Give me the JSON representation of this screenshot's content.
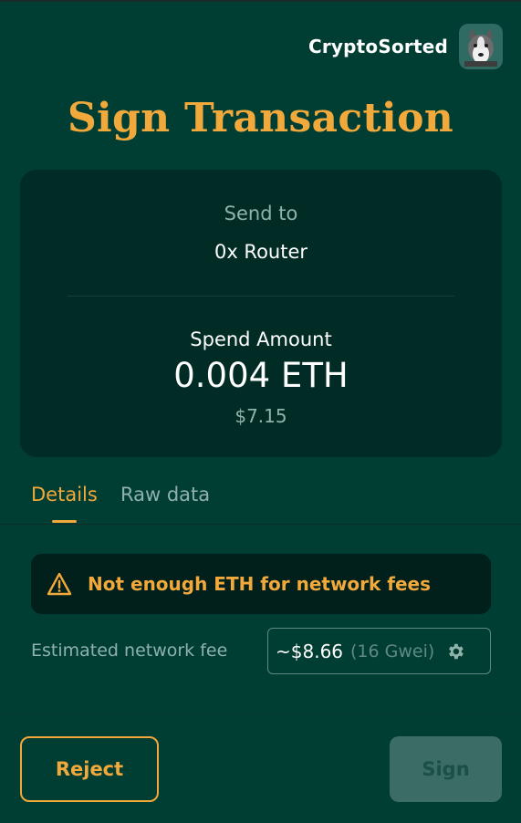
{
  "account": {
    "name": "CryptoSorted",
    "avatar_icon": "husky-dog-avatar"
  },
  "title": "Sign Transaction",
  "summary": {
    "send_to_label": "Send to",
    "send_to_value": "0x Router",
    "spend_label": "Spend Amount",
    "spend_value": "0.004 ETH",
    "spend_usd": "$7.15"
  },
  "tabs": [
    {
      "label": "Details",
      "active": true
    },
    {
      "label": "Raw data",
      "active": false
    }
  ],
  "warning": {
    "icon": "warning-triangle-icon",
    "text": "Not enough ETH for network fees"
  },
  "fee": {
    "label": "Estimated network fee",
    "usd": "~$8.66",
    "gwei": "(16 Gwei)",
    "icon": "gear-icon"
  },
  "actions": {
    "reject_label": "Reject",
    "sign_label": "Sign",
    "sign_enabled": false
  },
  "colors": {
    "background": "#003d33",
    "card": "#012c26",
    "accent": "#f2a93b",
    "muted_text": "#8fb2ab",
    "disabled_button": "#3b6d66"
  }
}
